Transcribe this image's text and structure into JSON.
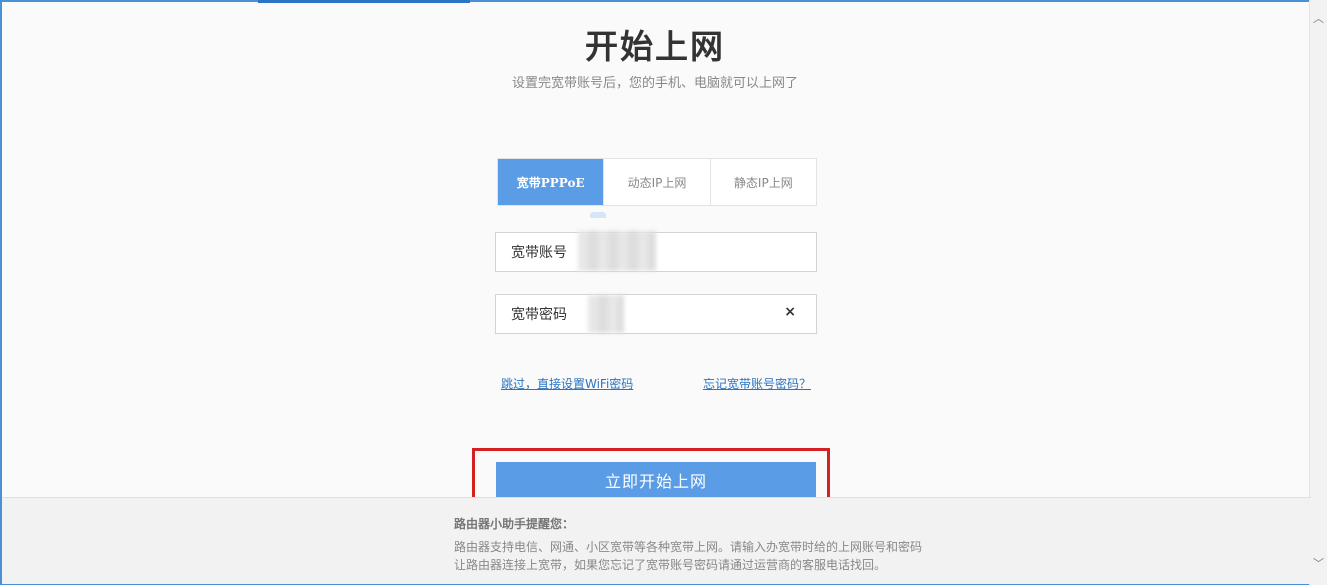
{
  "header": {
    "title": "开始上网",
    "subtitle": "设置完宽带账号后，您的手机、电脑就可以上网了"
  },
  "tabs": [
    {
      "label": "宽带PPPoE",
      "active": true
    },
    {
      "label": "动态IP上网",
      "active": false
    },
    {
      "label": "静态IP上网",
      "active": false
    }
  ],
  "form": {
    "account_label": "宽带账号",
    "account_value": "",
    "password_label": "宽带密码",
    "password_value": "",
    "clear_icon": "×"
  },
  "links": {
    "skip": "跳过，直接设置WiFi密码",
    "forgot": "忘记宽带账号密码？"
  },
  "actions": {
    "start_label": "立即开始上网"
  },
  "tips": {
    "title": "路由器小助手提醒您：",
    "line1": "路由器支持电信、网通、小区宽带等各种宽带上网。请输入办宽带时给的上网账号和密码",
    "line2": "让路由器连接上宽带，如果您忘记了宽带账号密码请通过运营商的客服电话找回。"
  },
  "icons": {
    "scroll_up": "chevron-up-icon",
    "scroll_down": "chevron-down-icon",
    "clear": "close-icon"
  },
  "colors": {
    "accent": "#5a9ce6",
    "link": "#2a74c2",
    "highlight": "#d42020"
  }
}
